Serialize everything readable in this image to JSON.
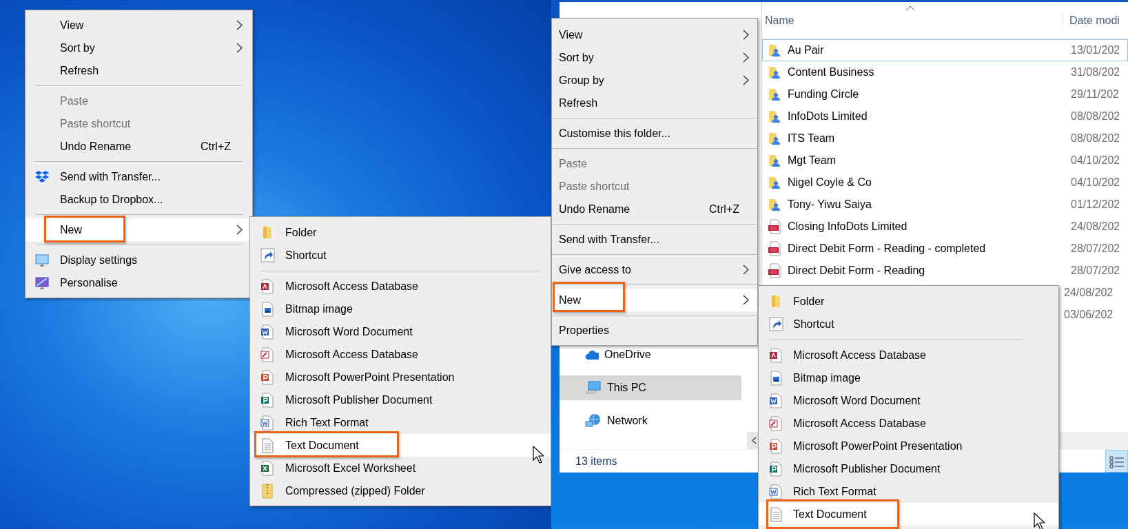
{
  "desktop_menu": {
    "items": [
      {
        "kind": "plain",
        "label": "View",
        "submenu": true,
        "disabled": false,
        "selected": false,
        "callout": false
      },
      {
        "kind": "plain",
        "label": "Sort by",
        "submenu": true,
        "disabled": false,
        "selected": false,
        "callout": false
      },
      {
        "kind": "plain",
        "label": "Refresh",
        "submenu": false,
        "disabled": false,
        "selected": false,
        "callout": false
      },
      {
        "kind": "separator"
      },
      {
        "kind": "plain",
        "label": "Paste",
        "submenu": false,
        "disabled": true,
        "selected": false,
        "callout": false
      },
      {
        "kind": "plain",
        "label": "Paste shortcut",
        "submenu": false,
        "disabled": true,
        "selected": false,
        "callout": false
      },
      {
        "kind": "plain",
        "label": "Undo Rename",
        "shortcut": "Ctrl+Z",
        "submenu": false,
        "disabled": false,
        "selected": false,
        "callout": false
      },
      {
        "kind": "separator"
      },
      {
        "kind": "dropbox",
        "label": "Send with Transfer...",
        "submenu": false,
        "disabled": false,
        "selected": false,
        "callout": false
      },
      {
        "kind": "plain",
        "label": "Backup to Dropbox...",
        "submenu": false,
        "disabled": false,
        "selected": false,
        "callout": false
      },
      {
        "kind": "separator"
      },
      {
        "kind": "plain",
        "label": "New",
        "submenu": true,
        "disabled": false,
        "selected": true,
        "callout": true
      },
      {
        "kind": "separator"
      },
      {
        "kind": "display",
        "label": "Display settings",
        "submenu": false,
        "disabled": false,
        "selected": false,
        "callout": false
      },
      {
        "kind": "personalise",
        "label": "Personalise",
        "submenu": false,
        "disabled": false,
        "selected": false,
        "callout": false
      }
    ]
  },
  "desktop_submenu": {
    "items": [
      {
        "kind": "folder",
        "label": "Folder",
        "selected": false,
        "callout": false
      },
      {
        "kind": "shortcut",
        "label": "Shortcut",
        "selected": false,
        "callout": false
      },
      {
        "kind": "separator"
      },
      {
        "kind": "access",
        "label": "Microsoft Access Database",
        "selected": false,
        "callout": false
      },
      {
        "kind": "bitmap",
        "label": "Bitmap image",
        "selected": false,
        "callout": false
      },
      {
        "kind": "word",
        "label": "Microsoft Word Document",
        "selected": false,
        "callout": false
      },
      {
        "kind": "access-alt",
        "label": "Microsoft Access Database",
        "selected": false,
        "callout": false
      },
      {
        "kind": "powerpoint",
        "label": "Microsoft PowerPoint Presentation",
        "selected": false,
        "callout": false
      },
      {
        "kind": "publisher",
        "label": "Microsoft Publisher Document",
        "selected": false,
        "callout": false
      },
      {
        "kind": "rtf",
        "label": "Rich Text Format",
        "selected": false,
        "callout": false
      },
      {
        "kind": "text",
        "label": "Text Document",
        "selected": true,
        "callout": true
      },
      {
        "kind": "excel",
        "label": "Microsoft Excel Worksheet",
        "selected": false,
        "callout": false
      },
      {
        "kind": "zip",
        "label": "Compressed (zipped) Folder",
        "selected": false,
        "callout": false
      }
    ]
  },
  "explorer": {
    "columns": [
      "Name",
      "Date modi"
    ],
    "files": [
      {
        "kind": "shared-folder",
        "name": "Au Pair",
        "date": "13/01/202",
        "focused": true
      },
      {
        "kind": "shared-folder",
        "name": "Content Business",
        "date": "31/08/202",
        "focused": false
      },
      {
        "kind": "shared-folder",
        "name": "Funding Circle",
        "date": "29/11/202",
        "focused": false
      },
      {
        "kind": "shared-folder",
        "name": "InfoDots Limited",
        "date": "08/08/202",
        "focused": false
      },
      {
        "kind": "shared-folder",
        "name": "ITS Team",
        "date": "08/08/202",
        "focused": false
      },
      {
        "kind": "shared-folder",
        "name": "Mgt Team",
        "date": "04/10/202",
        "focused": false
      },
      {
        "kind": "shared-folder",
        "name": "Nigel Coyle & Co",
        "date": "04/10/202",
        "focused": false
      },
      {
        "kind": "shared-folder",
        "name": "Tony- Yiwu Saiya",
        "date": "01/12/202",
        "focused": false
      },
      {
        "kind": "pdf",
        "name": "Closing InfoDots Limited",
        "date": "24/08/202",
        "focused": false
      },
      {
        "kind": "pdf",
        "name": "Direct Debit Form - Reading - completed",
        "date": "28/07/202",
        "focused": false
      },
      {
        "kind": "pdf",
        "name": "Direct Debit Form - Reading",
        "date": "28/07/202",
        "focused": false
      },
      {
        "date": "24/08/202",
        "focused": false
      },
      {
        "date": "03/06/202",
        "focused": false
      }
    ],
    "nav": [
      {
        "kind": "cloud",
        "label": "OneDrive",
        "selected": false
      },
      {
        "kind": "pc",
        "label": "This PC",
        "selected": true
      },
      {
        "kind": "network",
        "label": "Network",
        "selected": false
      }
    ],
    "status_bar": "13 items"
  },
  "explorer_menu": {
    "items": [
      {
        "kind": "plain",
        "label": "View",
        "submenu": true,
        "disabled": false,
        "selected": false,
        "callout": false
      },
      {
        "kind": "plain",
        "label": "Sort by",
        "submenu": true,
        "disabled": false,
        "selected": false,
        "callout": false
      },
      {
        "kind": "plain",
        "label": "Group by",
        "submenu": true,
        "disabled": false,
        "selected": false,
        "callout": false
      },
      {
        "kind": "plain",
        "label": "Refresh",
        "submenu": false,
        "disabled": false,
        "selected": false,
        "callout": false
      },
      {
        "kind": "separator"
      },
      {
        "kind": "plain",
        "label": "Customise this folder...",
        "submenu": false,
        "disabled": false,
        "selected": false,
        "callout": false
      },
      {
        "kind": "separator"
      },
      {
        "kind": "plain",
        "label": "Paste",
        "submenu": false,
        "disabled": true,
        "selected": false,
        "callout": false
      },
      {
        "kind": "plain",
        "label": "Paste shortcut",
        "submenu": false,
        "disabled": true,
        "selected": false,
        "callout": false
      },
      {
        "kind": "plain",
        "label": "Undo Rename",
        "shortcut": "Ctrl+Z",
        "submenu": false,
        "disabled": false,
        "selected": false,
        "callout": false
      },
      {
        "kind": "separator"
      },
      {
        "kind": "plain",
        "label": "Send with Transfer...",
        "submenu": false,
        "disabled": false,
        "selected": false,
        "callout": false
      },
      {
        "kind": "separator"
      },
      {
        "kind": "plain",
        "label": "Give access to",
        "submenu": true,
        "disabled": false,
        "selected": false,
        "callout": false
      },
      {
        "kind": "separator"
      },
      {
        "kind": "plain",
        "label": "New",
        "submenu": true,
        "disabled": false,
        "selected": true,
        "callout": true
      },
      {
        "kind": "separator"
      },
      {
        "kind": "plain",
        "label": "Properties",
        "submenu": false,
        "disabled": false,
        "selected": false,
        "callout": false
      }
    ]
  },
  "explorer_submenu": {
    "items": [
      {
        "kind": "folder",
        "label": "Folder",
        "selected": false,
        "callout": false
      },
      {
        "kind": "shortcut",
        "label": "Shortcut",
        "selected": false,
        "callout": false
      },
      {
        "kind": "separator"
      },
      {
        "kind": "access",
        "label": "Microsoft Access Database",
        "selected": false,
        "callout": false
      },
      {
        "kind": "bitmap",
        "label": "Bitmap image",
        "selected": false,
        "callout": false
      },
      {
        "kind": "word",
        "label": "Microsoft Word Document",
        "selected": false,
        "callout": false
      },
      {
        "kind": "access-alt",
        "label": "Microsoft Access Database",
        "selected": false,
        "callout": false
      },
      {
        "kind": "powerpoint",
        "label": "Microsoft PowerPoint Presentation",
        "selected": false,
        "callout": false
      },
      {
        "kind": "publisher",
        "label": "Microsoft Publisher Document",
        "selected": false,
        "callout": false
      },
      {
        "kind": "rtf",
        "label": "Rich Text Format",
        "selected": false,
        "callout": false
      },
      {
        "kind": "text",
        "label": "Text Document",
        "selected": true,
        "callout": true
      }
    ]
  }
}
